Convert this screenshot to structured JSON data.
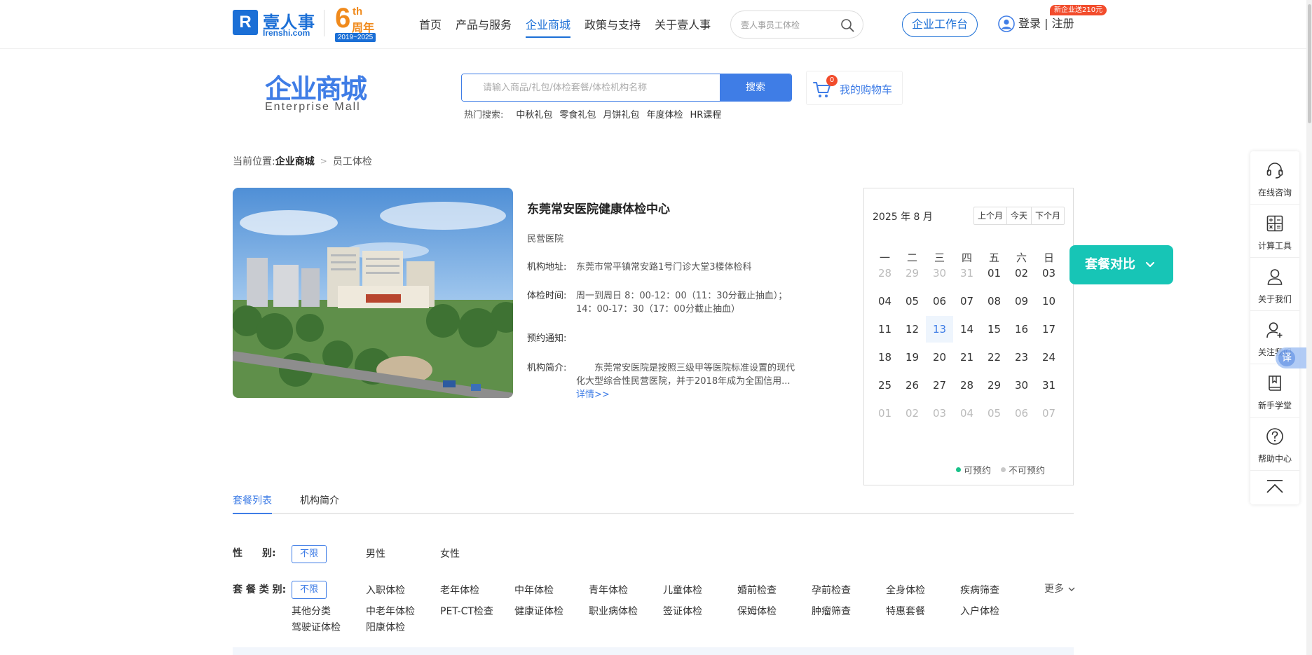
{
  "brand": {
    "mark": "R",
    "name_cn": "壹人事",
    "name_en": "Irenshi.com",
    "anniv_num": "6",
    "anniv_th": "th",
    "anniv_zh": "周年",
    "anniv_years": "2019~2025"
  },
  "nav": {
    "items": [
      "首页",
      "产品与服务",
      "企业商城",
      "政策与支持",
      "关于壹人事"
    ],
    "active_index": 2
  },
  "top_search": {
    "placeholder": "壹人事员工体检"
  },
  "header": {
    "workbench": "企业工作台",
    "login": "登录 | 注册",
    "promo": "新企业送210元"
  },
  "mall": {
    "title": "企业商城",
    "subtitle": "Enterprise Mall",
    "search_placeholder": "请输入商品/礼包/体检套餐/体检机构名称",
    "search_btn": "搜索",
    "cart_count": "0",
    "cart_label": "我的购物车",
    "hot_label": "热门搜索:",
    "hot_items": [
      "中秋礼包",
      "零食礼包",
      "月饼礼包",
      "年度体检",
      "HR课程"
    ]
  },
  "breadcrumb": {
    "prefix": "当前位置:",
    "level1": "企业商城",
    "level2": "员工体检"
  },
  "hospital": {
    "name": "东莞常安医院健康体检中心",
    "type": "民营医院",
    "address_label": "机构地址:",
    "address": "东莞市常平镇常安路1号门诊大堂3楼体检科",
    "time_label": "体检时间:",
    "time_line1": "周一到周日 8：00-12：00（11：30分截止抽血）；",
    "time_line2": "14：00-17：30（17：00分截止抽血）",
    "notice_label": "预约通知:",
    "intro_label": "机构简介:",
    "intro_line1": "东莞常安医院是按照三级甲等医院标准设置的现代",
    "intro_line2": "化大型综合性民营医院，并于2018年成为全国信用...",
    "detail_link": "详情>>"
  },
  "calendar": {
    "title": "2025 年 8 月",
    "nav": [
      "上个月",
      "今天",
      "下个月"
    ],
    "weekdays": [
      "一",
      "二",
      "三",
      "四",
      "五",
      "六",
      "日"
    ],
    "rows": [
      [
        "28",
        "29",
        "30",
        "31",
        "01",
        "02",
        "03"
      ],
      [
        "04",
        "05",
        "06",
        "07",
        "08",
        "09",
        "10"
      ],
      [
        "11",
        "12",
        "13",
        "14",
        "15",
        "16",
        "17"
      ],
      [
        "18",
        "19",
        "20",
        "21",
        "22",
        "23",
        "24"
      ],
      [
        "25",
        "26",
        "27",
        "28",
        "29",
        "30",
        "31"
      ],
      [
        "01",
        "02",
        "03",
        "04",
        "05",
        "06",
        "07"
      ]
    ],
    "today": "13",
    "legend_available": "可预约",
    "legend_unavailable": "不可预约",
    "available_color": "#19c28a",
    "unavailable_color": "#c8c8c8"
  },
  "compare": {
    "label": "套餐对比"
  },
  "sidebar": {
    "items": [
      "在线咨询",
      "计算工具",
      "关于我们",
      "关注我们",
      "新手学堂",
      "帮助中心"
    ],
    "translate": "译"
  },
  "tabs": {
    "items": [
      "套餐列表",
      "机构简介"
    ],
    "active_index": 0
  },
  "filters": {
    "gender_label": "性　　别:",
    "gender_options": [
      "不限",
      "男性",
      "女性"
    ],
    "category_label": "套 餐 类 别:",
    "category_options_row1": [
      "不限",
      "入职体检",
      "老年体检",
      "中年体检",
      "青年体检",
      "儿童体检",
      "婚前检查",
      "孕前检查",
      "全身体检",
      "疾病筛查"
    ],
    "category_options_row2": [
      "其他分类",
      "中老年体检",
      "PET-CT检查",
      "健康证体检",
      "职业病体检",
      "签证体检",
      "保姆体检",
      "肿瘤筛查",
      "特惠套餐",
      "入户体检"
    ],
    "category_options_row3": [
      "驾驶证体检",
      "阳康体检"
    ],
    "more": "更多"
  },
  "colors": {
    "primary": "#3f7de6",
    "brand_blue": "#1b6fd6",
    "teal": "#17c5b6",
    "orange": "#f08a1c",
    "red": "#f24c2c"
  }
}
